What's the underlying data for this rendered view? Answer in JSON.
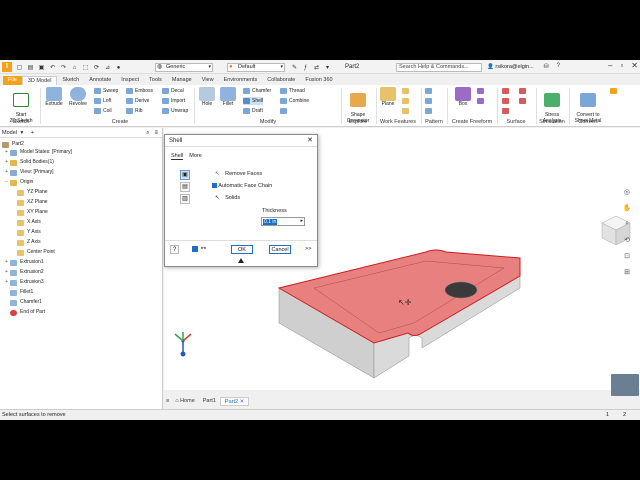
{
  "app": {
    "logo_text": "I",
    "material": "Generic",
    "appearance": "Default",
    "doc_title": "Part2",
    "search_placeholder": "Search Help & Commands...",
    "user": "rsikora@elgin..."
  },
  "tabs": [
    "File",
    "3D Model",
    "Sketch",
    "Annotate",
    "Inspect",
    "Tools",
    "Manage",
    "View",
    "Environments",
    "Collaborate",
    "Fusion 360"
  ],
  "ribbon": {
    "start_sketch": "Start\n2D Sketch",
    "extrude": "Extrude",
    "revolve": "Revolve",
    "sweep": "Sweep",
    "loft": "Loft",
    "coil": "Coil",
    "emboss": "Emboss",
    "derive": "Derive",
    "rib": "Rib",
    "decal": "Decal",
    "import": "Import",
    "unwrap": "Unwrap",
    "hole": "Hole",
    "fillet": "Fillet",
    "chamfer": "Chamfer",
    "shell": "Shell",
    "draft": "Draft",
    "thread": "Thread",
    "combine": "Combine",
    "shape_generator": "Shape\nGenerator",
    "plane": "Plane",
    "box": "Box",
    "stress_analysis": "Stress\nAnalysis",
    "convert_sheet_metal": "Convert to\nSheet Metal",
    "groups": {
      "sketch": "Sketch",
      "create": "Create",
      "modify": "Modify",
      "explore": "Explore",
      "work_features": "Work Features",
      "pattern": "Pattern",
      "create_freeform": "Create Freeform",
      "surface": "Surface",
      "simulation": "Simulation",
      "convert": "Convert"
    }
  },
  "browser": {
    "title": "Model",
    "items": [
      {
        "label": "Part2"
      },
      {
        "label": "Model States: [Primary]"
      },
      {
        "label": "Solid Bodies(1)"
      },
      {
        "label": "View: [Primary]"
      },
      {
        "label": "Origin"
      },
      {
        "label": "YZ Plane"
      },
      {
        "label": "XZ Plane"
      },
      {
        "label": "XY Plane"
      },
      {
        "label": "X Axis"
      },
      {
        "label": "Y Axis"
      },
      {
        "label": "Z Axis"
      },
      {
        "label": "Center Point"
      },
      {
        "label": "Extrusion1"
      },
      {
        "label": "Extrusion2"
      },
      {
        "label": "Extrusion3"
      },
      {
        "label": "Fillet1"
      },
      {
        "label": "Chamfer1"
      },
      {
        "label": "End of Part"
      }
    ]
  },
  "dialog": {
    "title": "Shell",
    "tab_shell": "Shell",
    "tab_more": "More",
    "remove_faces": "Remove Faces",
    "auto_face_chain": "Automatic Face Chain",
    "solids": "Solids",
    "thickness_label": "Thickness",
    "thickness_value": "0.1 in",
    "ok": "OK",
    "cancel": "Cancel",
    "expand": ">>"
  },
  "doc_tabs": [
    "Home",
    "Part1",
    "Part2"
  ],
  "status": {
    "message": "Select surfaces to remove",
    "n1": "1",
    "n2": "2"
  },
  "colors": {
    "accent": "#1a6fc9",
    "file_tab": "#f3a21a",
    "selection_face": "#e06b6b",
    "body_gray": "#d4d4d4"
  }
}
